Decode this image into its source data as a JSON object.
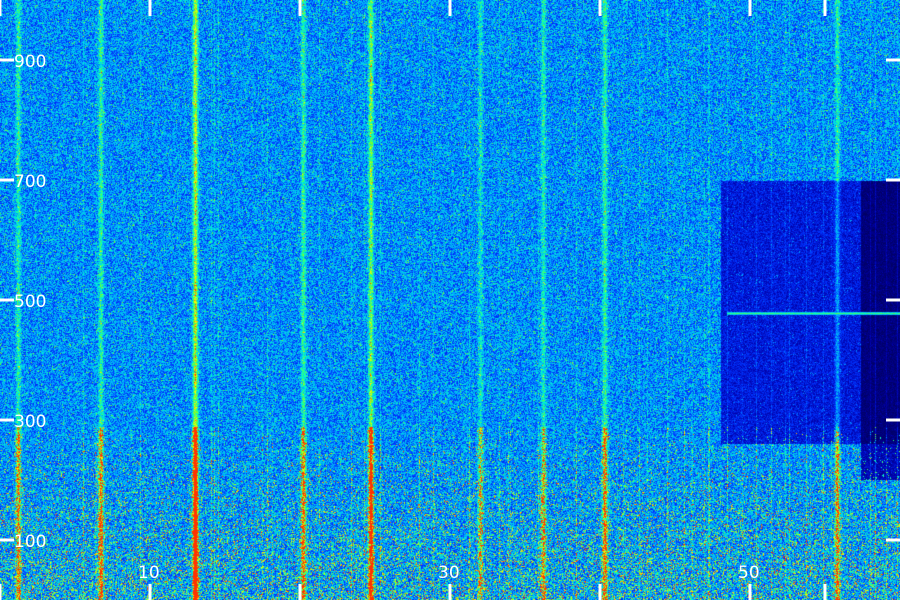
{
  "chart_data": {
    "type": "heatmap",
    "title": "",
    "xlabel": "",
    "ylabel": "",
    "xlim": [
      0,
      60
    ],
    "ylim": [
      0,
      1000
    ],
    "x_tick_labels": [
      {
        "value": 10,
        "label": "10"
      },
      {
        "value": 30,
        "label": "30"
      },
      {
        "value": 50,
        "label": "50"
      }
    ],
    "x_minor_ticks": [
      0,
      10,
      20,
      30,
      40,
      50,
      55
    ],
    "y_tick_labels": [
      {
        "value": 100,
        "label": "100"
      },
      {
        "value": 300,
        "label": "300"
      },
      {
        "value": 500,
        "label": "500"
      },
      {
        "value": 700,
        "label": "700"
      },
      {
        "value": 900,
        "label": "900"
      }
    ],
    "colormap": [
      "#000033",
      "#0000aa",
      "#0033ff",
      "#00aaff",
      "#00ffcc",
      "#66ff33",
      "#ffff00",
      "#ff3300"
    ],
    "background_color": "#000022",
    "vertical_streaks": [
      {
        "x": 13.0,
        "intensity": 0.95
      },
      {
        "x": 24.7,
        "intensity": 0.75
      },
      {
        "x": 20.2,
        "intensity": 0.5
      },
      {
        "x": 6.7,
        "intensity": 0.5
      },
      {
        "x": 1.2,
        "intensity": 0.45
      },
      {
        "x": 40.3,
        "intensity": 0.5
      },
      {
        "x": 36.2,
        "intensity": 0.4
      },
      {
        "x": 55.8,
        "intensity": 0.45
      },
      {
        "x": 32.0,
        "intensity": 0.35
      }
    ],
    "horizontal_features": [
      {
        "y": 478,
        "x_start": 48.5,
        "x_end": 60,
        "intensity": 0.6
      }
    ],
    "dark_region": {
      "x_start": 48,
      "x_end": 60,
      "y_start": 260,
      "y_end": 700
    },
    "low_freq_band": {
      "y_start": 0,
      "y_end": 290,
      "intensity": 0.55
    }
  }
}
